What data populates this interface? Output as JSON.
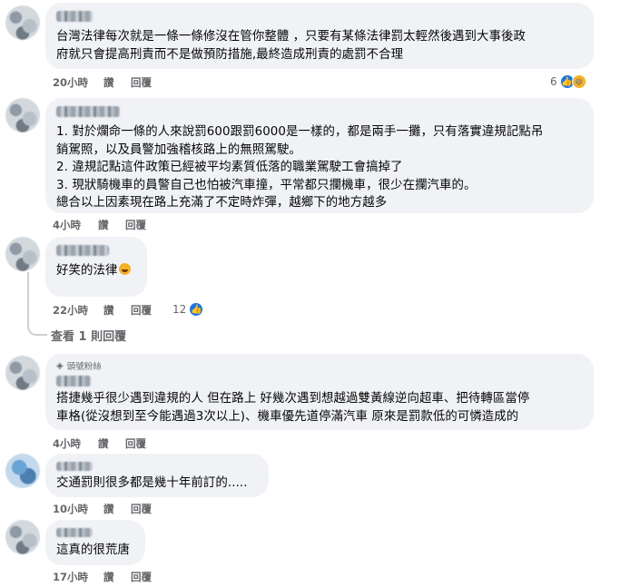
{
  "comments": [
    {
      "text": "台灣法律每次就是一條一條修沒在管你整體 ，只要有某條法律罰太輕然後遇到大事後政\n府就只會提高刑責而不是做預防措施,最終造成刑責的處罰不合理",
      "time": "20小時",
      "like": "讚",
      "reply": "回覆",
      "reactions": "6"
    },
    {
      "text": "1. 對於爛命一條的人來說罰600跟罰6000是一樣的，都是兩手一攤，只有落實違規記點吊\n銷駕照，以及員警加強稽核路上的無照駕駛。\n2. 違規記點這件政策已經被平均素質低落的職業駕駛工會搞掉了\n3. 現狀騎機車的員警自己也怕被汽車撞，平常都只攔機車，很少在攔汽車的。\n總合以上因素現在路上充滿了不定時炸彈，越鄉下的地方越多",
      "time": "4小時",
      "like": "讚",
      "reply": "回覆"
    },
    {
      "text": "好笑的法律",
      "time": "22小時",
      "like": "讚",
      "reply": "回覆",
      "reactions": "12"
    },
    {
      "badge": "頭號粉絲",
      "text": "搭捷幾乎很少遇到違規的人 但在路上 好幾次遇到想越過雙黃線逆向超車、把待轉區當停\n車格(從沒想到至今能遇過3次以上)、機車優先道停滿汽車 原來是罰款低的可憐造成的",
      "time": "4小時",
      "like": "讚",
      "reply": "回覆"
    },
    {
      "text": "交通罰則很多都是幾十年前訂的.....",
      "time": "10小時",
      "like": "讚",
      "reply": "回覆"
    },
    {
      "text": "這真的很荒唐",
      "time": "17小時",
      "like": "讚",
      "reply": "回覆"
    }
  ],
  "view_replies": "查看 1 則回覆"
}
